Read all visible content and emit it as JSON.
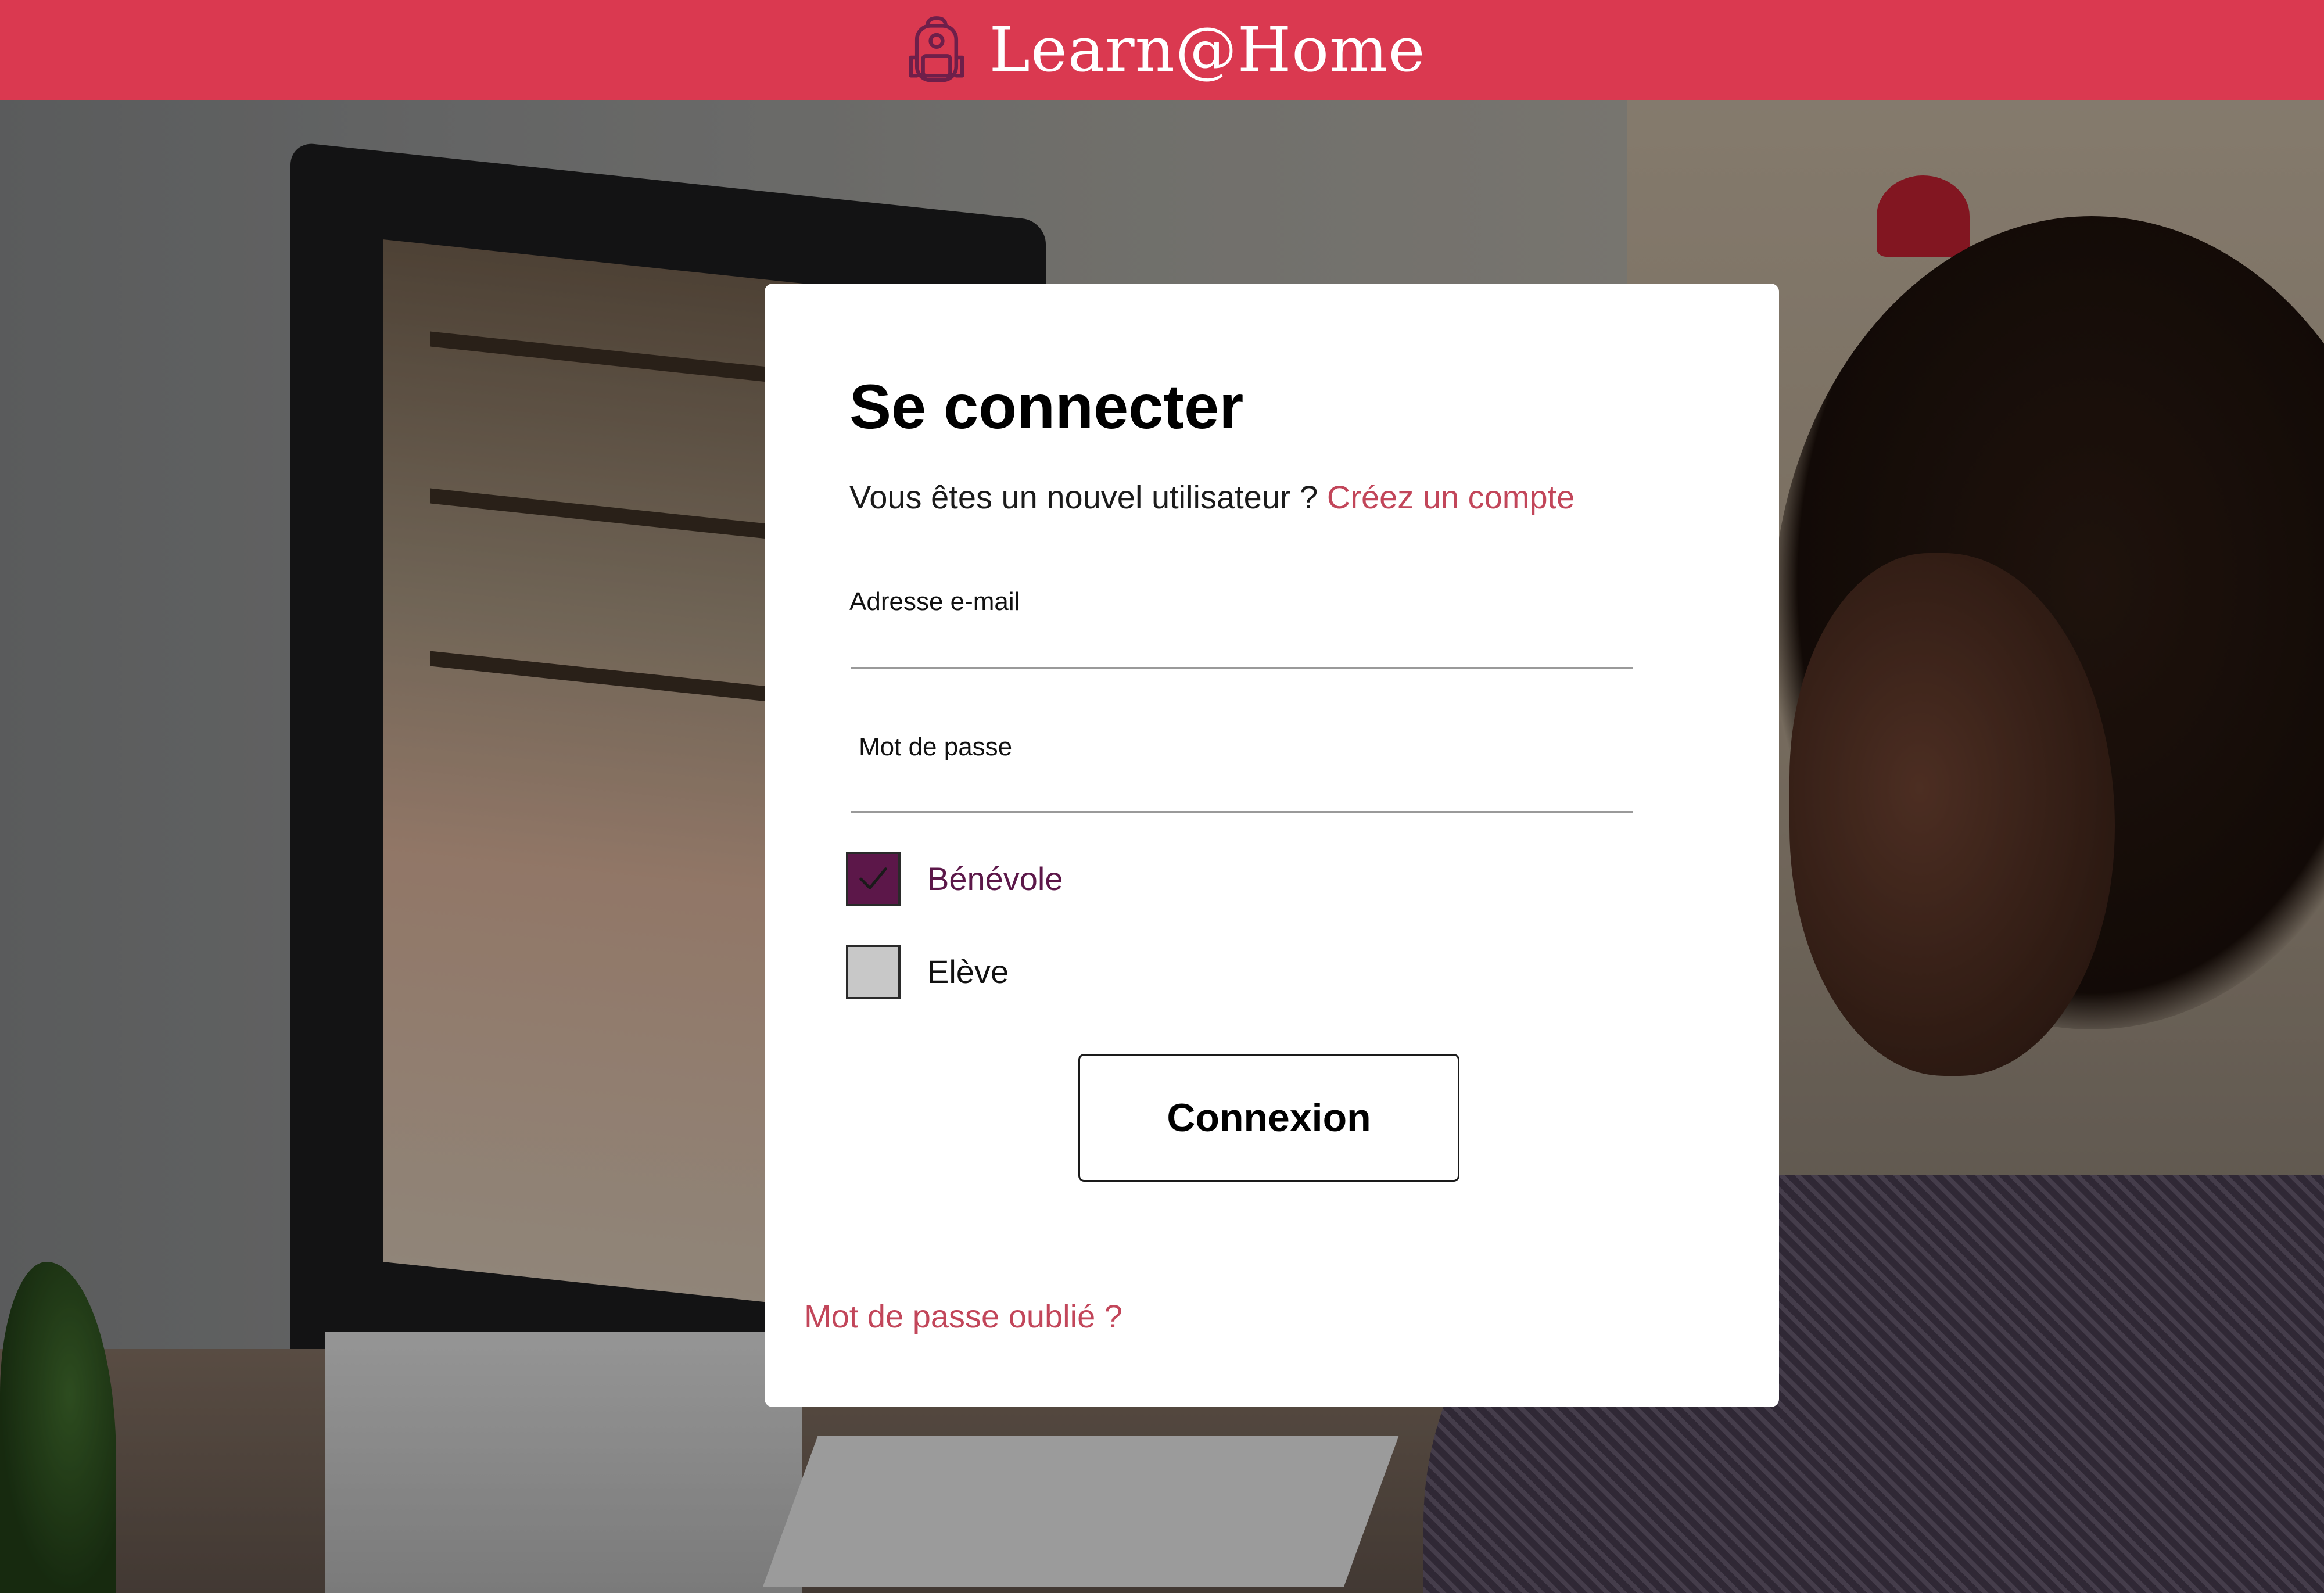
{
  "app": {
    "brand_name": "Learn@Home",
    "brand_icon": "backpack-icon",
    "accent_color": "#da3950",
    "link_color": "#c2465a",
    "selected_color": "#5c1749"
  },
  "login": {
    "title": "Se connecter",
    "new_user_prompt": "Vous êtes un nouvel utilisateur ?",
    "create_account_link": "Créez un compte",
    "email": {
      "label": "Adresse e-mail",
      "value": ""
    },
    "password": {
      "label": "Mot de passe",
      "value": ""
    },
    "roles": [
      {
        "label": "Bénévole",
        "checked": true
      },
      {
        "label": "Elève",
        "checked": false
      }
    ],
    "submit_label": "Connexion",
    "forgot_password_link": "Mot de passe oublié ?"
  }
}
